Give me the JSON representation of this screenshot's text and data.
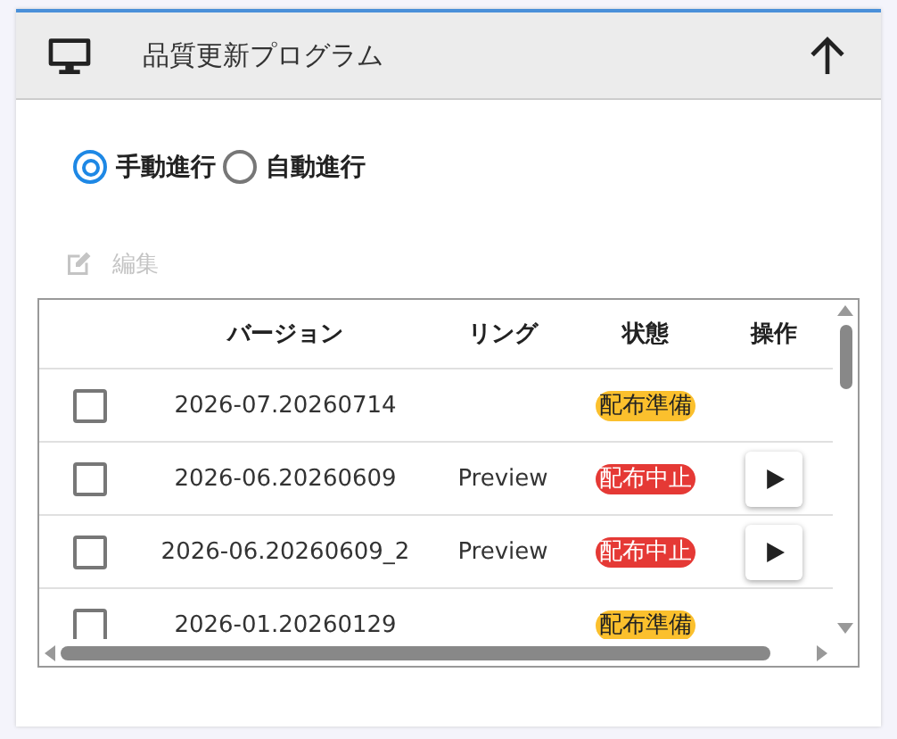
{
  "header": {
    "title": "品質更新プログラム"
  },
  "modes": [
    {
      "label": "手動進行",
      "selected": true
    },
    {
      "label": "自動進行",
      "selected": false
    }
  ],
  "edit_button": {
    "label": "編集",
    "disabled": true
  },
  "table": {
    "columns": [
      "バージョン",
      "リング",
      "状態",
      "操作"
    ],
    "rows": [
      {
        "checked": false,
        "version": "2026-07.20260714",
        "ring": "",
        "status": "配布準備",
        "color": "#fbc02d",
        "playable": false
      },
      {
        "checked": false,
        "version": "2026-06.20260609",
        "ring": "Preview",
        "status": "配布中止",
        "color": "#e53935",
        "playable": true
      },
      {
        "checked": false,
        "version": "2026-06.20260609_2",
        "ring": "Preview",
        "status": "配布中止",
        "color": "#e53935",
        "playable": true
      },
      {
        "checked": false,
        "version": "2026-01.20260129",
        "ring": "",
        "status": "配布準備",
        "color": "#fbc02d",
        "playable": false
      }
    ]
  }
}
